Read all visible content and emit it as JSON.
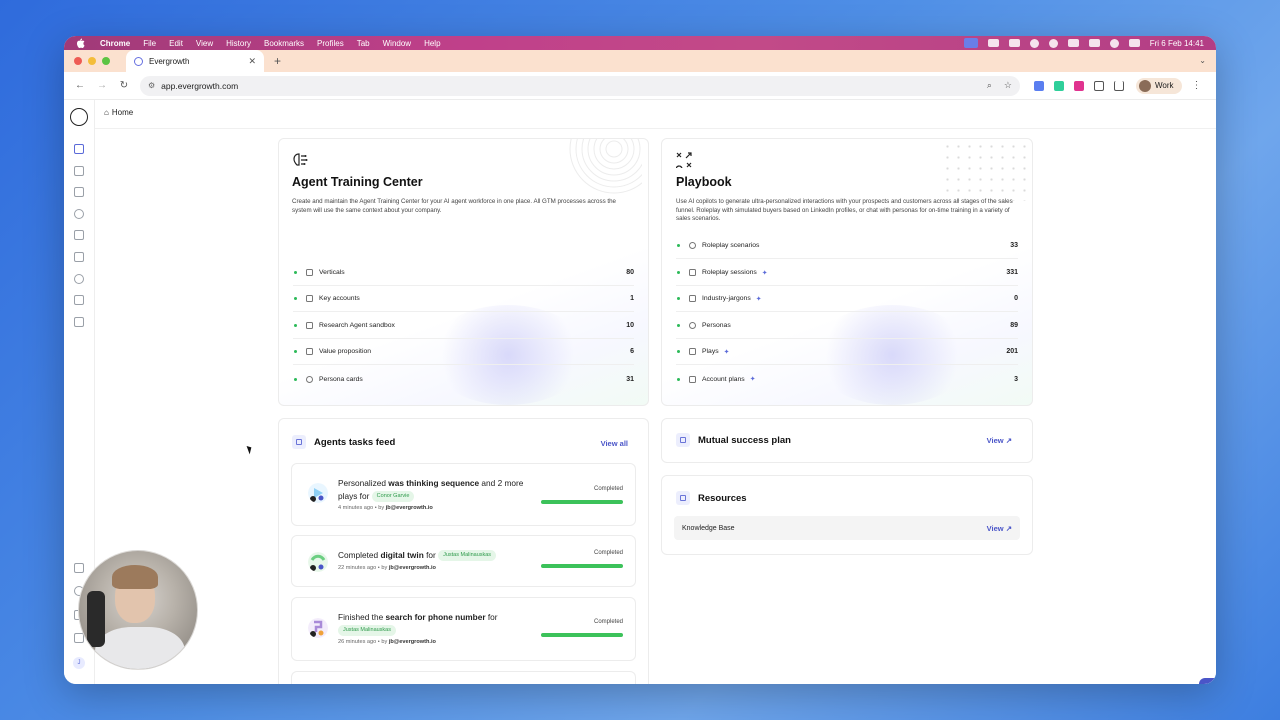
{
  "menubar": {
    "app": "Chrome",
    "items": [
      "File",
      "Edit",
      "View",
      "History",
      "Bookmarks",
      "Profiles",
      "Tab",
      "Window",
      "Help"
    ],
    "datetime": "Fri 6 Feb  14:41"
  },
  "browser": {
    "tab_title": "Evergrowth",
    "url": "app.evergrowth.com",
    "profile": "Work"
  },
  "breadcrumb": {
    "label": "Home"
  },
  "agent_training": {
    "title": "Agent Training Center",
    "description": "Create and maintain the Agent Training Center for your AI agent workforce in one place. All GTM processes across the system will use the same context about your company.",
    "rows": [
      {
        "label": "Verticals",
        "value": "80"
      },
      {
        "label": "Key accounts",
        "value": "1"
      },
      {
        "label": "Research Agent sandbox",
        "value": "10"
      },
      {
        "label": "Value proposition",
        "value": "6"
      },
      {
        "label": "Persona cards",
        "value": "31"
      }
    ]
  },
  "playbook": {
    "title": "Playbook",
    "description": "Use AI copilots to generate ultra-personalized interactions with your prospects and customers across all stages of the sales funnel. Roleplay with simulated buyers based on LinkedIn profiles, or chat with personas for on-time training in a variety of sales scenarios.",
    "rows": [
      {
        "label": "Roleplay scenarios",
        "value": "33",
        "ai": false
      },
      {
        "label": "Roleplay sessions",
        "value": "331",
        "ai": true
      },
      {
        "label": "Industry-jargons",
        "value": "0",
        "ai": true
      },
      {
        "label": "Personas",
        "value": "89",
        "ai": false
      },
      {
        "label": "Plays",
        "value": "201",
        "ai": true
      },
      {
        "label": "Account plans",
        "value": "3",
        "ai": true
      }
    ]
  },
  "tasks_feed": {
    "title": "Agents tasks feed",
    "view_all": "View all",
    "tasks": [
      {
        "pre": "Personalized ",
        "bold": "was thinking sequence",
        "post": " and 2 more plays for ",
        "person": "Conor Garvie",
        "time": "4 minutes ago",
        "by": "by",
        "user": "jb@evergrowth.io",
        "status": "Completed",
        "progress": 100
      },
      {
        "pre": "Completed ",
        "bold": "digital twin",
        "post": " for ",
        "person": "Justas Malinauskas",
        "time": "22 minutes ago",
        "by": "by",
        "user": "jb@evergrowth.io",
        "status": "Completed",
        "progress": 100
      },
      {
        "pre": "Finished the ",
        "bold": "search for phone number",
        "post": " for ",
        "person": "Justas Malinauskas",
        "time": "26 minutes ago",
        "by": "by",
        "user": "jb@evergrowth.io",
        "status": "Completed",
        "progress": 100
      }
    ]
  },
  "mutual_success": {
    "title": "Mutual success plan",
    "link": "View"
  },
  "resources": {
    "title": "Resources",
    "items": [
      {
        "label": "Knowledge Base",
        "link": "View"
      }
    ]
  },
  "sidebar": {
    "avatar_initial": "J"
  },
  "colors": {
    "accent": "#4a55c8",
    "success": "#3cc25a",
    "menubar": "#c0408a",
    "tabstrip": "#fbe1cf"
  }
}
